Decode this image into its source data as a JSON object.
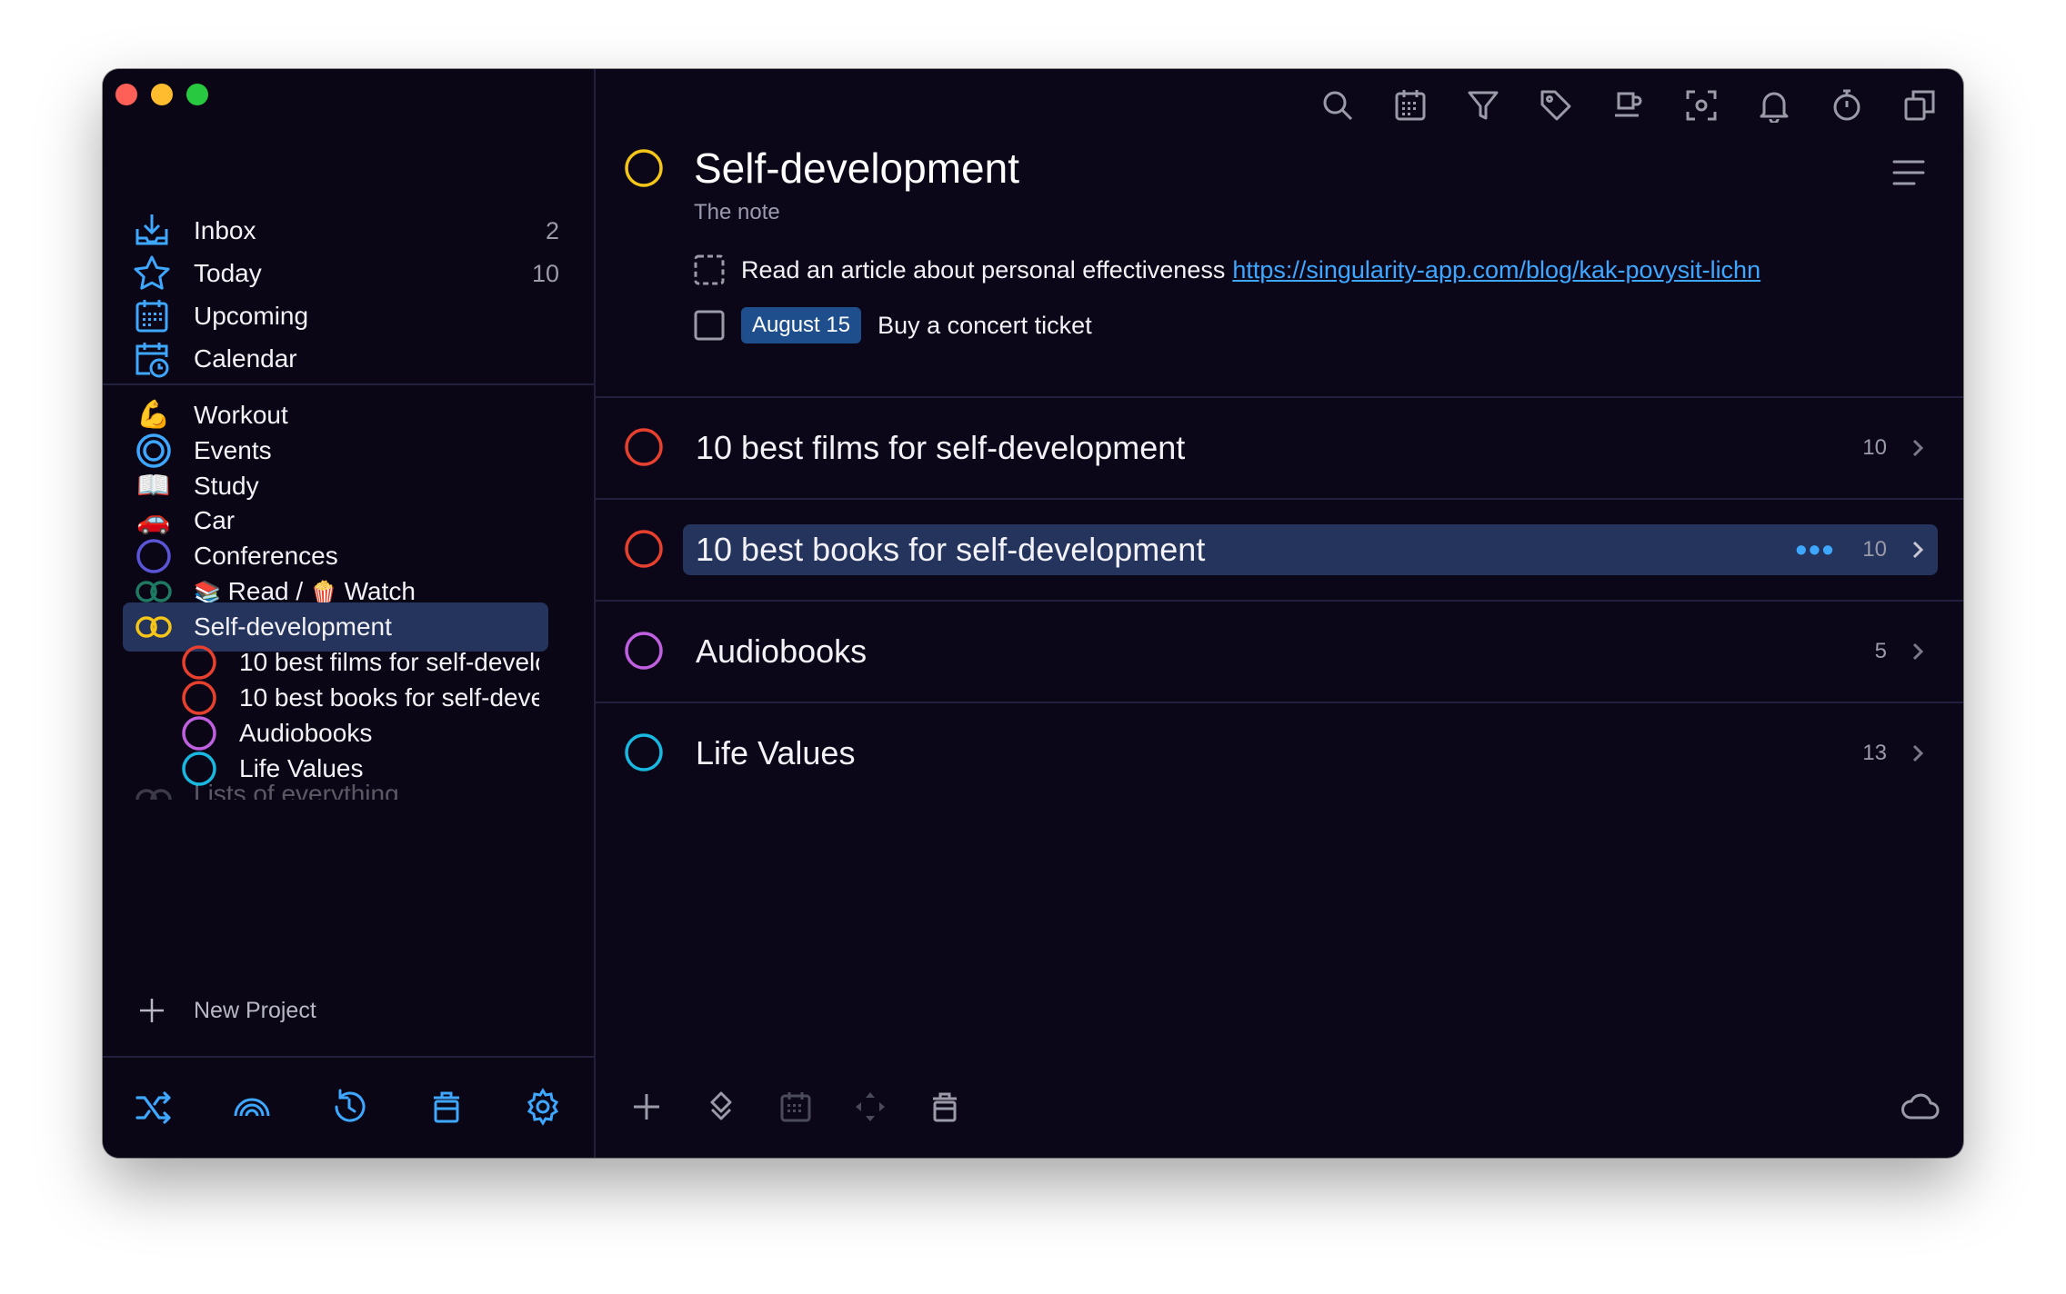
{
  "sidebar": {
    "nav": [
      {
        "label": "Inbox",
        "count": "2",
        "icon": "inbox-icon"
      },
      {
        "label": "Today",
        "count": "10",
        "icon": "star-icon"
      },
      {
        "label": "Upcoming",
        "count": "",
        "icon": "calendar-grid-icon"
      },
      {
        "label": "Calendar",
        "count": "",
        "icon": "calendar-clock-icon"
      }
    ],
    "projects": [
      {
        "label": "Workout",
        "icon": "flexed-biceps-emoji",
        "glyph": "💪"
      },
      {
        "label": "Events",
        "icon": "target-circle-icon"
      },
      {
        "label": "Study",
        "icon": "open-book-emoji",
        "glyph": "📖"
      },
      {
        "label": "Car",
        "icon": "car-emoji",
        "glyph": "🚗"
      },
      {
        "label": "Conferences",
        "icon": "project-circle-icon"
      },
      {
        "label_read": "Read /",
        "label_watch": "Watch",
        "glyph_books": "📚",
        "glyph_popcorn": "🍿",
        "icon": "linked-rings-icon"
      },
      {
        "label": "Self-development",
        "icon": "linked-rings-icon"
      }
    ],
    "subprojects": [
      {
        "label": "10 best films for self-development"
      },
      {
        "label": "10 best books for self-development"
      },
      {
        "label": "Audiobooks"
      },
      {
        "label": "Life Values"
      }
    ],
    "faded_project": "Lists of everything",
    "new_project": "New Project"
  },
  "main": {
    "title": "Self-development",
    "note": "The note",
    "tasks": [
      {
        "text": "Read an article about personal effectiveness",
        "link": "https://singularity-app.com/blog/kak-povysit-lichn"
      },
      {
        "date": "August 15",
        "text": "Buy a concert ticket"
      }
    ],
    "rows": [
      {
        "label": "10 best films for self-development",
        "count": "10"
      },
      {
        "label": "10 best books for self-development",
        "count": "10",
        "more": "•••"
      },
      {
        "label": "Audiobooks",
        "count": "5"
      },
      {
        "label": "Life Values",
        "count": "13"
      }
    ]
  },
  "colors": {
    "accent": "#3ea7ff",
    "yellow": "#f5c518",
    "red": "#e8402f",
    "purple": "#c060e0",
    "cyan": "#18b8e0",
    "indigo": "#5a55d6",
    "green": "#1f7a63",
    "selected": "#25345c"
  }
}
